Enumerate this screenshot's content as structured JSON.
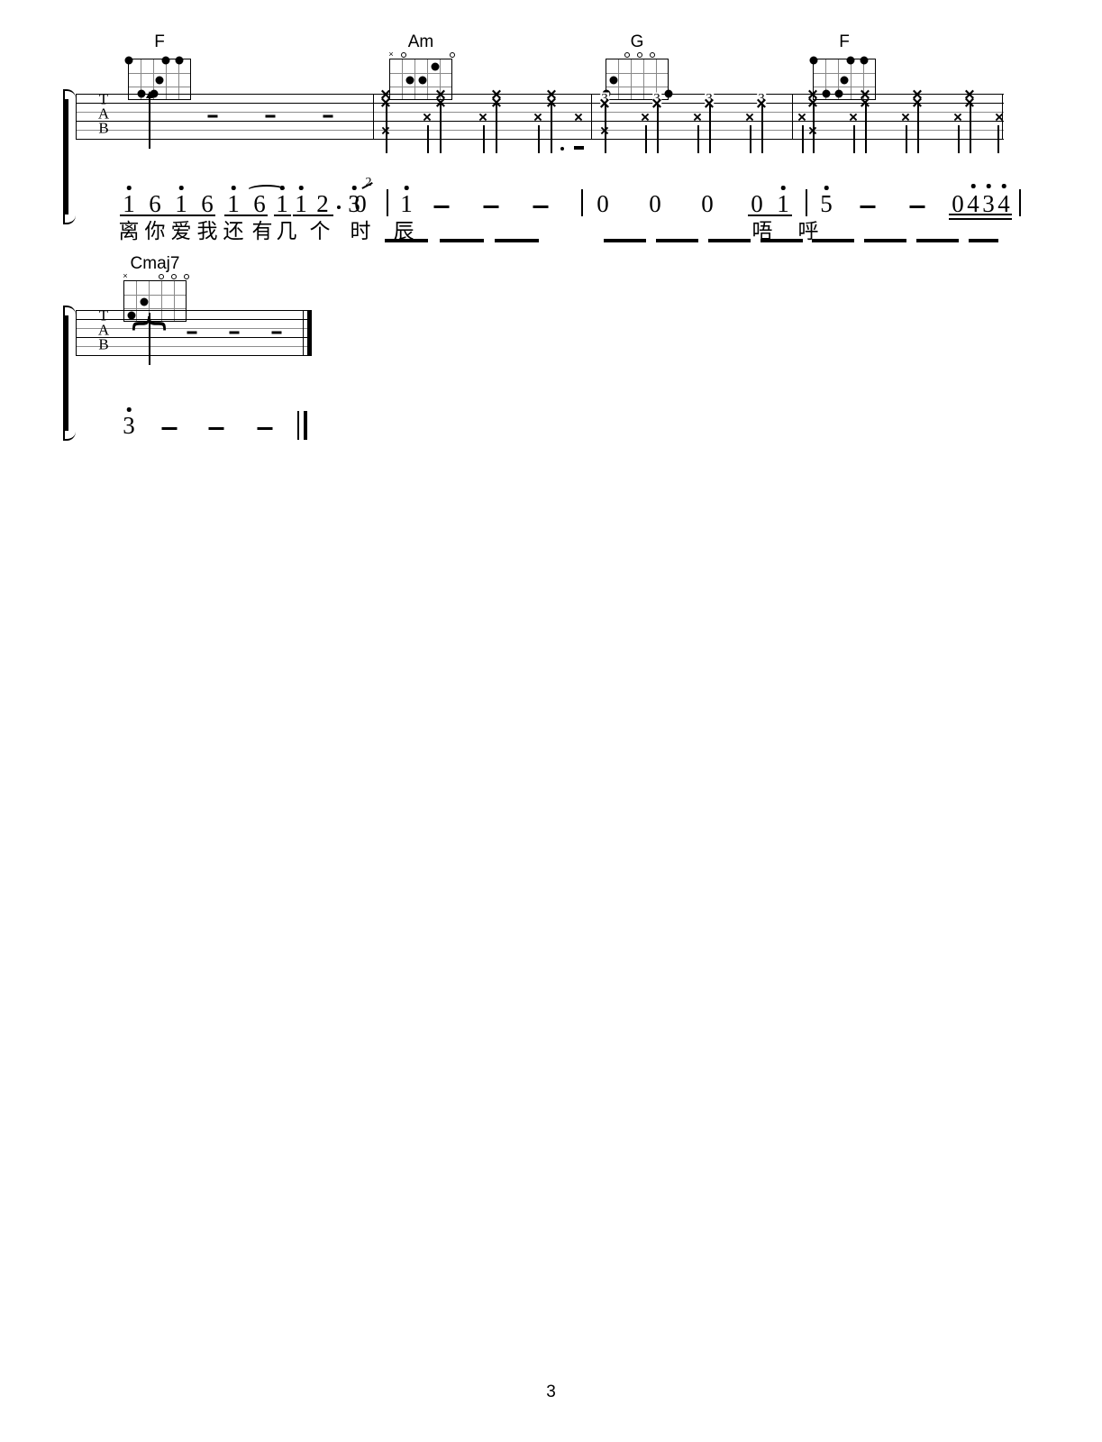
{
  "document": {
    "type": "guitar-tablature",
    "page_number": "3"
  },
  "chords": [
    {
      "name": "F",
      "markers": [],
      "dots": [
        {
          "string": 6,
          "fret": 1
        },
        {
          "string": 5,
          "fret": 3
        },
        {
          "string": 4,
          "fret": 3
        },
        {
          "string": 3,
          "fret": 2
        },
        {
          "string": 2,
          "fret": 1
        },
        {
          "string": 1,
          "fret": 1
        }
      ]
    },
    {
      "name": "Am",
      "markers": [
        {
          "string": 6,
          "symbol": "x"
        },
        {
          "string": 5,
          "symbol": "o"
        },
        {
          "string": 1,
          "symbol": "o"
        }
      ],
      "dots": [
        {
          "string": 4,
          "fret": 2
        },
        {
          "string": 3,
          "fret": 2
        },
        {
          "string": 2,
          "fret": 1
        }
      ]
    },
    {
      "name": "G",
      "markers": [
        {
          "string": 4,
          "symbol": "o"
        },
        {
          "string": 3,
          "symbol": "o"
        },
        {
          "string": 2,
          "symbol": "o"
        }
      ],
      "dots": [
        {
          "string": 6,
          "fret": 3
        },
        {
          "string": 5,
          "fret": 2
        },
        {
          "string": 1,
          "fret": 3
        }
      ]
    },
    {
      "name": "F",
      "markers": [],
      "dots": [
        {
          "string": 6,
          "fret": 1
        },
        {
          "string": 5,
          "fret": 3
        },
        {
          "string": 4,
          "fret": 3
        },
        {
          "string": 3,
          "fret": 2
        },
        {
          "string": 2,
          "fret": 1
        },
        {
          "string": 1,
          "fret": 1
        }
      ]
    },
    {
      "name": "Cmaj7",
      "markers": [
        {
          "string": 6,
          "symbol": "x"
        },
        {
          "string": 3,
          "symbol": "o"
        },
        {
          "string": 2,
          "symbol": "o"
        },
        {
          "string": 1,
          "symbol": "o"
        }
      ],
      "dots": [
        {
          "string": 5,
          "fret": 3
        },
        {
          "string": 4,
          "fret": 2
        }
      ]
    }
  ],
  "staff": {
    "letters": [
      "T",
      "A",
      "B"
    ]
  },
  "system1": {
    "measures": [
      {
        "chord": "F",
        "strum": "arpeggio-up",
        "rest_dashes": 3
      },
      {
        "chord": "Am",
        "strums": [
          "x",
          "x",
          "x",
          "x",
          "x",
          "x",
          "x",
          "x"
        ]
      },
      {
        "chord": "G",
        "fret_numbers": [
          "3",
          "3",
          "3",
          "3"
        ],
        "strums": [
          "x",
          "x",
          "x",
          "x",
          "x",
          "x",
          "x",
          "x"
        ]
      },
      {
        "chord": "F",
        "strums": [
          "x",
          "x",
          "x",
          "x",
          "x",
          "x",
          "x",
          "x"
        ]
      }
    ]
  },
  "system2": {
    "measures": [
      {
        "chord": "Cmaj7",
        "strum": "arpeggio-roll",
        "rest_dashes": 3,
        "ending": "double-barline"
      }
    ]
  },
  "jianpu": {
    "line1": {
      "notes": [
        {
          "text": "1",
          "octave_up": 1,
          "beam": 1
        },
        {
          "text": "6",
          "octave_up": 0,
          "beam": 1
        },
        {
          "text": "1",
          "octave_up": 1,
          "beam": 1
        },
        {
          "text": "6",
          "octave_up": 0,
          "beam": 1
        },
        {
          "text": "1",
          "octave_up": 1,
          "beam": 1
        },
        {
          "text": "6",
          "octave_up": 0,
          "beam": 1
        },
        {
          "text": "1",
          "octave_up": 1,
          "beam": 1
        },
        {
          "text": "1",
          "octave_up": 1,
          "beam": 1
        },
        {
          "text": "2",
          "octave_up": 0,
          "dotted": true
        },
        {
          "text": "0",
          "octave_up": 0
        },
        {
          "text": "3",
          "octave_up": 1,
          "grace": "2"
        },
        {
          "text": "1",
          "octave_up": 1
        },
        {
          "text": "0",
          "octave_up": 0
        },
        {
          "text": "0",
          "octave_up": 0
        },
        {
          "text": "0",
          "octave_up": 0
        },
        {
          "text": "0",
          "octave_up": 0,
          "beam": 1
        },
        {
          "text": "1",
          "octave_up": 1,
          "beam": 1
        },
        {
          "text": "5",
          "octave_up": 1
        },
        {
          "text": "0",
          "octave_up": 0,
          "beam": 2
        },
        {
          "text": "4",
          "octave_up": 1,
          "beam": 2
        },
        {
          "text": "3",
          "octave_up": 1,
          "beam": 2
        },
        {
          "text": "4",
          "octave_up": 1,
          "beam": 2
        }
      ],
      "lyrics": [
        "离",
        "你",
        "爱",
        "我",
        "还",
        "有",
        "几",
        "个",
        "时",
        "辰",
        "唔",
        "呼"
      ]
    },
    "line2": {
      "notes": [
        {
          "text": "3",
          "octave_up": 1
        }
      ],
      "dashes": 3
    }
  }
}
